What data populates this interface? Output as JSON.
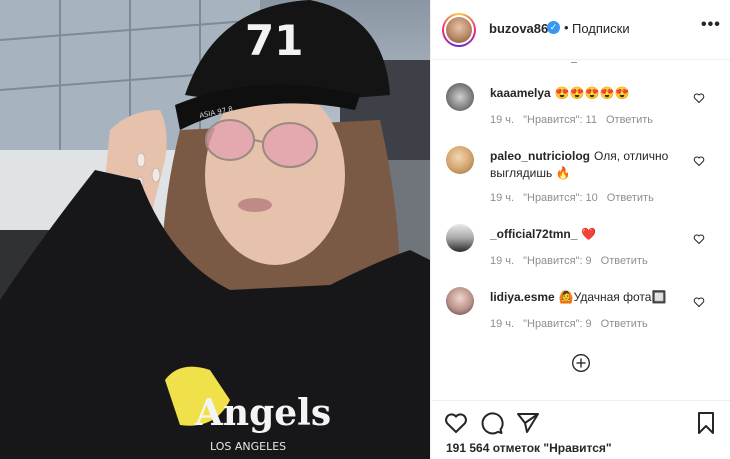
{
  "post": {
    "username": "buzova86",
    "follow_label": "Подписки",
    "separator": "•",
    "more_label": "•••",
    "verified_mark": "✓",
    "photo": {
      "cap_text": "71",
      "cap_band_text": "ASIA 97 8",
      "hoodie_text": "Angels",
      "hoodie_subtext": "LOS ANGELES"
    }
  },
  "comments": [
    {
      "username": "kaaamelya",
      "text": "😍😍😍😍😍",
      "time": "19 ч.",
      "likes": "\"Нравится\": 11",
      "reply": "Ответить"
    },
    {
      "username": "paleo_nutriciolog",
      "text": "Оля, отлично выглядишь 🔥",
      "time": "19 ч.",
      "likes": "\"Нравится\": 10",
      "reply": "Ответить"
    },
    {
      "username": "_official72tmn_",
      "text": "❤️",
      "time": "19 ч.",
      "likes": "\"Нравится\": 9",
      "reply": "Ответить"
    },
    {
      "username": "lidiya.esme",
      "text": "🙆Удачная фота🔲",
      "time": "19 ч.",
      "likes": "\"Нравится\": 9",
      "reply": "Ответить"
    }
  ],
  "footer": {
    "likes_text": "191 564 отметок \"Нравится\""
  },
  "icons": {
    "like": "heart-icon",
    "comment": "comment-icon",
    "share": "share-icon",
    "save": "bookmark-icon",
    "load_more": "add-circle-icon"
  }
}
